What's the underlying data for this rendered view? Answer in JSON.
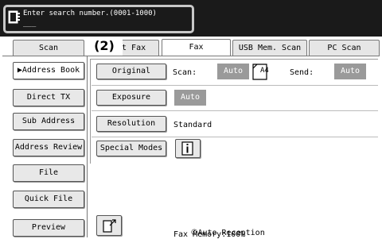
{
  "search": {
    "prompt": "Enter search number.(0001-1000)",
    "value": "___"
  },
  "tabs": [
    {
      "label": "Scan",
      "active": false
    },
    {
      "label": "Internet Fax",
      "active": false
    },
    {
      "label": "Fax",
      "active": true
    },
    {
      "label": "USB Mem. Scan",
      "active": false
    },
    {
      "label": "PC Scan",
      "active": false
    }
  ],
  "callout": "(2)",
  "tab_internet_fax_visible": "et Fax",
  "sidebar": {
    "address_book": "Address Book",
    "direct_tx": "Direct TX",
    "sub_address": "Sub Address",
    "address_review": "Address Review",
    "file": "File",
    "quick_file": "Quick File",
    "preview": "Preview"
  },
  "main": {
    "original_button": "Original",
    "scan_label": "Scan:",
    "scan_value": "Auto",
    "paper_size": "A4",
    "send_label": "Send:",
    "send_value": "Auto",
    "exposure_button": "Exposure",
    "exposure_value": "Auto",
    "resolution_button": "Resolution",
    "resolution_value": "Standard",
    "special_modes_button": "Special Modes"
  },
  "status": {
    "auto_reception": "Auto Reception",
    "fax_memory": "Fax Memory:100%"
  },
  "colors": {
    "top_bar": "#1a1a1a",
    "badge_gray": "#9a9a9a"
  }
}
